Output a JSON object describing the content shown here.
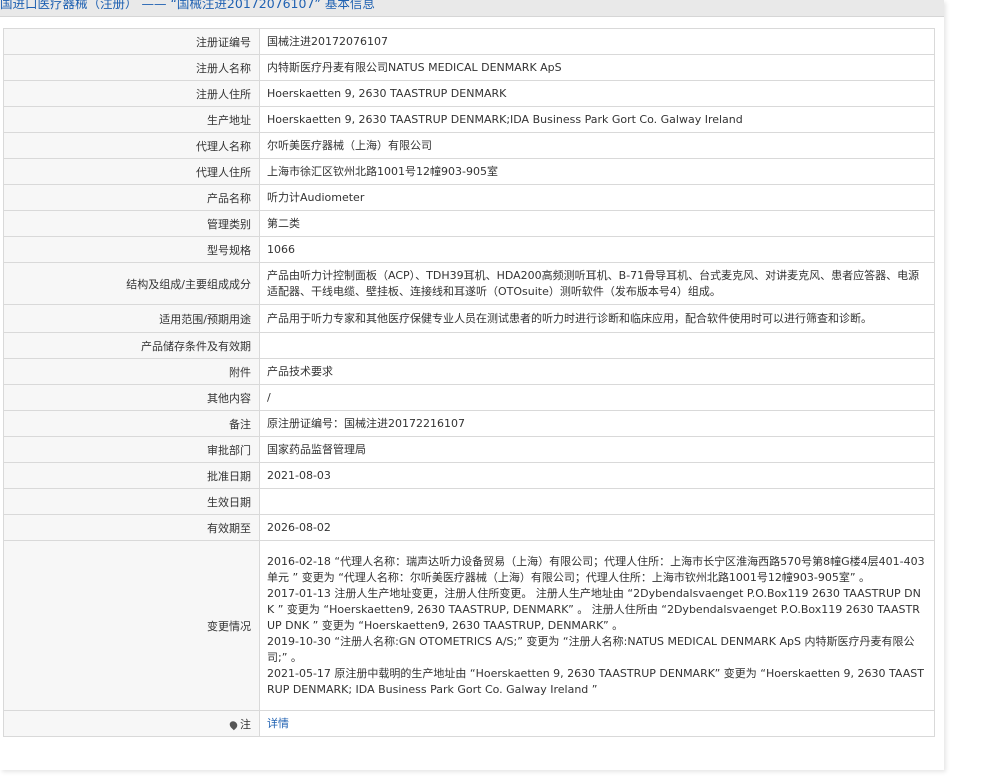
{
  "header": {
    "title": "国进口医疗器械（注册） —— “国械注进20172076107” 基本信息"
  },
  "rows": [
    {
      "label": "注册证编号",
      "value": "国械注进20172076107"
    },
    {
      "label": "注册人名称",
      "value": "内特斯医疗丹麦有限公司NATUS MEDICAL DENMARK ApS"
    },
    {
      "label": "注册人住所",
      "value": "Hoerskaetten 9, 2630 TAASTRUP DENMARK"
    },
    {
      "label": "生产地址",
      "value": "Hoerskaetten 9, 2630 TAASTRUP DENMARK;IDA Business Park Gort Co. Galway Ireland"
    },
    {
      "label": "代理人名称",
      "value": "尔听美医疗器械（上海）有限公司"
    },
    {
      "label": "代理人住所",
      "value": "上海市徐汇区钦州北路1001号12幢903-905室"
    },
    {
      "label": "产品名称",
      "value": "听力计Audiometer"
    },
    {
      "label": "管理类别",
      "value": "第二类"
    },
    {
      "label": "型号规格",
      "value": "1066"
    },
    {
      "label": "结构及组成/主要组成成分",
      "value": "产品由听力计控制面板（ACP）、TDH39耳机、HDA200高频测听耳机、B-71骨导耳机、台式麦克风、对讲麦克风、患者应答器、电源适配器、干线电缆、壁挂板、连接线和耳遂听（OTOsuite）测听软件（发布版本号4）组成。"
    },
    {
      "label": "适用范围/预期用途",
      "value": "产品用于听力专家和其他医疗保健专业人员在测试患者的听力时进行诊断和临床应用，配合软件使用时可以进行筛查和诊断。"
    },
    {
      "label": "产品储存条件及有效期",
      "value": ""
    },
    {
      "label": "附件",
      "value": "产品技术要求"
    },
    {
      "label": "其他内容",
      "value": "/"
    },
    {
      "label": "备注",
      "value": "原注册证编号：国械注进20172216107"
    },
    {
      "label": "审批部门",
      "value": "国家药品监督管理局"
    },
    {
      "label": "批准日期",
      "value": "2021-08-03"
    },
    {
      "label": "生效日期",
      "value": ""
    },
    {
      "label": "有效期至",
      "value": "2026-08-02"
    }
  ],
  "changes": {
    "label": "变更情况",
    "lines": [
      "2016-02-18 “代理人名称：瑞声达听力设备贸易（上海）有限公司；代理人住所：上海市长宁区淮海西路570号第8幢G楼4层401-403单元 ” 变更为 “代理人名称：尔听美医疗器械（上海）有限公司；代理人住所：上海市钦州北路1001号12幢903-905室” 。",
      "2017-01-13 注册人生产地址变更，注册人住所变更。 注册人生产地址由 “2Dybendalsvaenget P.O.Box119 2630 TAASTRUP DNK ” 变更为 “Hoerskaetten9, 2630 TAASTRUP, DENMARK” 。 注册人住所由 “2Dybendalsvaenget P.O.Box119 2630 TAASTRUP DNK ” 变更为 “Hoerskaetten9, 2630 TAASTRUP, DENMARK” 。",
      "2019-10-30 “注册人名称:GN OTOMETRICS A/S;” 变更为 “注册人名称:NATUS MEDICAL DENMARK ApS 内特斯医疗丹麦有限公司;” 。",
      "2021-05-17 原注册中载明的生产地址由 “Hoerskaetten 9, 2630 TAASTRUP DENMARK” 变更为 “Hoerskaetten 9, 2630 TAASTRUP DENMARK; IDA Business Park Gort Co. Galway Ireland ”"
    ]
  },
  "note": {
    "label": "注",
    "icon": "map-pin-icon",
    "link_text": "详情"
  }
}
